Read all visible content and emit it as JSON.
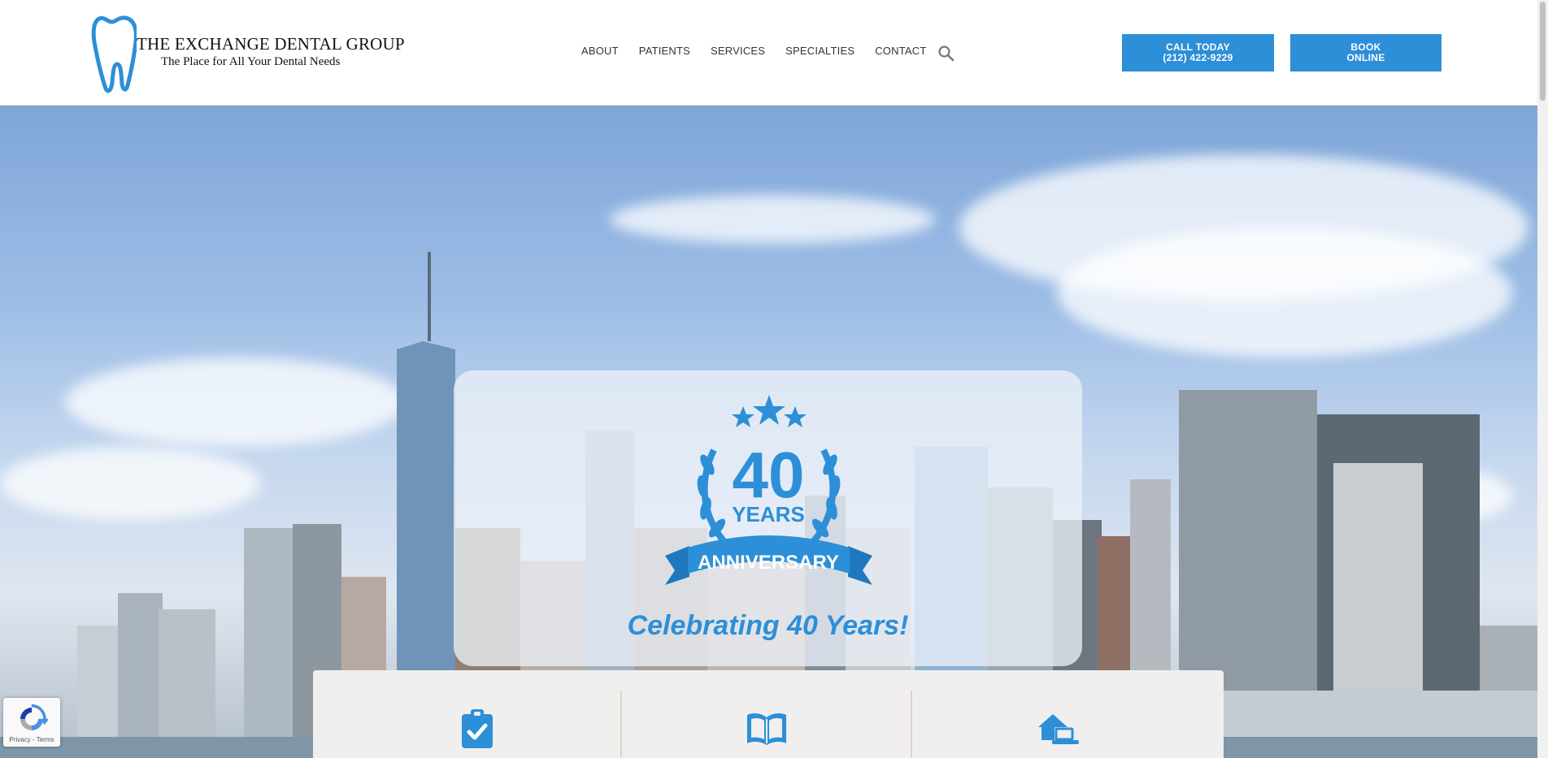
{
  "brand": {
    "name": "THE EXCHANGE DENTAL GROUP",
    "tagline": "The Place for All Your Dental Needs",
    "color": "#2c8fd8"
  },
  "nav": {
    "items": [
      {
        "label": "ABOUT"
      },
      {
        "label": "PATIENTS"
      },
      {
        "label": "SERVICES"
      },
      {
        "label": "SPECIALTIES"
      },
      {
        "label": "CONTACT"
      }
    ],
    "search_icon": "search-icon"
  },
  "cta": {
    "call_line1": "CALL TODAY",
    "call_line2": "(212) 422-9229",
    "book_line1": "BOOK",
    "book_line2": "ONLINE"
  },
  "hero": {
    "badge_number": "40",
    "badge_years": "YEARS",
    "badge_ribbon": "ANNIVERSARY",
    "headline": "Celebrating 40 Years!"
  },
  "cards": {
    "icons": [
      "clipboard-check-icon",
      "open-book-icon",
      "house-laptop-icon"
    ]
  },
  "recaptcha": {
    "links": "Privacy - Terms"
  }
}
